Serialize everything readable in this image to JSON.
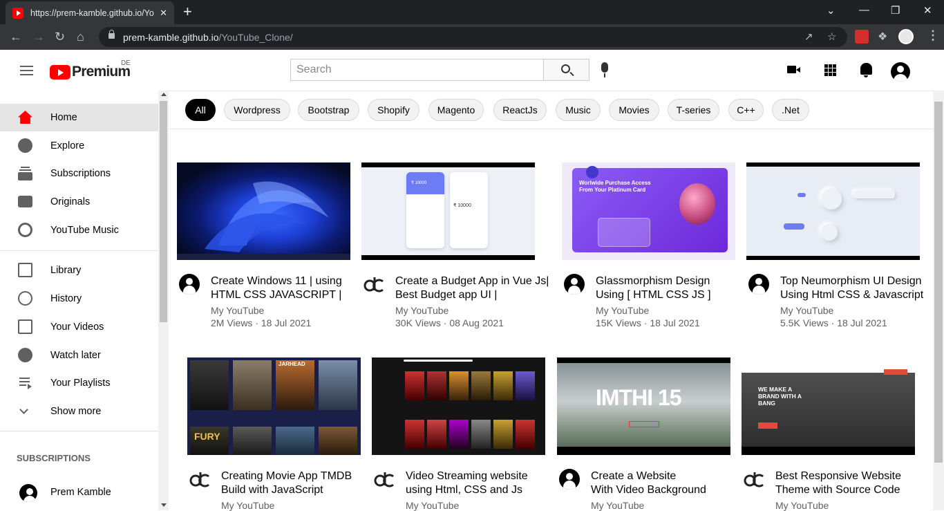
{
  "browser": {
    "tab_title": "https://prem-kamble.github.io/Yo",
    "tab_close": "✕",
    "new_tab": "+",
    "url_host": "prem-kamble.github.io",
    "url_path": "/YouTube_Clone/",
    "window_controls": [
      "⌄",
      "—",
      "❐",
      "✕"
    ]
  },
  "header": {
    "logo_text": "Premium",
    "country_code": "DE",
    "search_placeholder": "Search"
  },
  "sidebar": {
    "primary": [
      {
        "label": "Home",
        "icon": "home-icon",
        "active": true
      },
      {
        "label": "Explore",
        "icon": "compass-icon"
      },
      {
        "label": "Subscriptions",
        "icon": "subscriptions-icon"
      },
      {
        "label": "Originals",
        "icon": "originals-icon"
      },
      {
        "label": "YouTube Music",
        "icon": "music-icon"
      }
    ],
    "secondary": [
      {
        "label": "Library",
        "icon": "library-icon"
      },
      {
        "label": "History",
        "icon": "history-icon"
      },
      {
        "label": "Your Videos",
        "icon": "your-videos-icon"
      },
      {
        "label": "Watch later",
        "icon": "clock-icon"
      },
      {
        "label": "Your Playlists",
        "icon": "playlist-icon"
      },
      {
        "label": "Show more",
        "icon": "chevron-down-icon"
      }
    ],
    "subscriptions_title": "SUBSCRIPTIONS",
    "subscriptions": [
      {
        "label": "Prem Kamble",
        "icon": "avatar-icon"
      }
    ]
  },
  "chips": [
    "All",
    "Wordpress",
    "Bootstrap",
    "Shopify",
    "Magento",
    "ReactJs",
    "Music",
    "Movies",
    "T-series",
    "C++",
    ".Net"
  ],
  "videos": [
    {
      "title": "Create Windows 11 | using\nHTML CSS JAVASCRIPT |",
      "channel": "My YouTube",
      "meta": "2M Views · 18 Jul 2021",
      "channel_icon": "avatar"
    },
    {
      "title": "Create a Budget App in Vue Js|\nBest Budget app UI |",
      "channel": "My YouTube",
      "meta": "30K Views · 08 Aug 2021",
      "channel_icon": "dc-logo"
    },
    {
      "title": "Glassmorphism Design\nUsing [ HTML CSS JS ]",
      "channel": "My YouTube",
      "meta": "15K Views · 18 Jul 2021",
      "channel_icon": "avatar"
    },
    {
      "title": "Top Neumorphism UI Design\nUsing Html CSS & Javascript",
      "channel": "My YouTube",
      "meta": "5.5K Views · 18 Jul 2021",
      "channel_icon": "avatar"
    },
    {
      "title": "Creating Movie App TMDB\nBuild with JavaScript",
      "channel": "My YouTube",
      "meta": "",
      "channel_icon": "dc-logo"
    },
    {
      "title": "Video Streaming website\nusing Html, CSS and Js",
      "channel": "My YouTube",
      "meta": "",
      "channel_icon": "dc-logo"
    },
    {
      "title": "Create a Website\nWith Video Background",
      "channel": "My YouTube",
      "meta": "",
      "channel_icon": "avatar"
    },
    {
      "title": "Best Responsive Website\nTheme with Source Code",
      "channel": "My YouTube",
      "meta": "",
      "channel_icon": "dc-logo"
    }
  ],
  "thumb_text": {
    "glass_heading": "Worlwide Purchase Access\nFrom Your Platinum Card",
    "budget_amount": "₹ 10000",
    "imthi": "IMTHI 15",
    "bang": "WE MAKE A\nBRAND WITH A\nBANG",
    "jarhead": "JARHEAD",
    "fury": "FURY"
  }
}
